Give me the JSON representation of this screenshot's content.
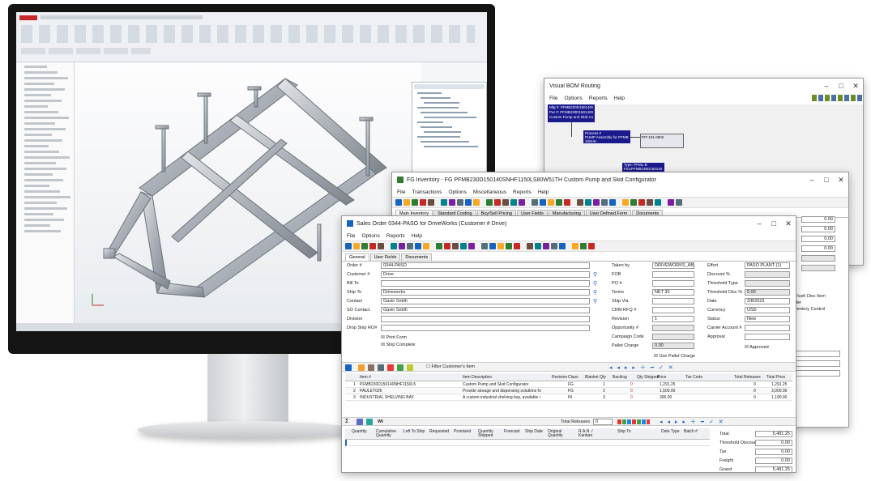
{
  "monitor": {
    "cad": {
      "tree_rows": 30
    }
  },
  "bom_window": {
    "title": "Visual BOM Routing",
    "menu": [
      "File",
      "Options",
      "Reports",
      "Help"
    ],
    "node1": [
      "Mfg #: PFMB230D150140SNH1150L5",
      "Pur #: PFMB230D150140SNH1150L5",
      "Custom Pump and Skid Configu"
    ],
    "node2": [
      "Process #",
      "PUMP Assembly for PFMB",
      "150HH"
    ],
    "node3": "PIT-101-0502",
    "node4": [
      "Type: PFML-B",
      "F01/PFMB230D150140",
      "Quan: 1"
    ]
  },
  "fg_window": {
    "title": "FG Inventory - FG PFMB230D150140SNHF1150LS80W51TH Custom Pump and Skid Configurator",
    "menu": [
      "File",
      "Transactions",
      "Options",
      "Miscellaneous",
      "Reports",
      "Help"
    ],
    "tabs": [
      "Main Inventory",
      "Standard Costing",
      "Buy/Sell Pricing",
      "User Fields",
      "Manufacturing",
      "User Defined Form",
      "Documents"
    ],
    "right_values": [
      "0.00",
      "0.00",
      "0.00",
      "0.00"
    ],
    "side_text": [
      "Flush Disc Item",
      "der",
      "ventory Control"
    ]
  },
  "so_window": {
    "title": "Sales Order 0344-PASO for DriveWorks (Customer # Drive)",
    "menu": [
      "File",
      "Options",
      "Reports",
      "Help"
    ],
    "tabs": [
      "General",
      "User Fields",
      "Documents"
    ],
    "left_fields": [
      {
        "label": "Order #",
        "value": "0344-PASO"
      },
      {
        "label": "Customer #",
        "value": "Drive"
      },
      {
        "label": "Bill To",
        "value": ""
      },
      {
        "label": "Ship To",
        "value": "Driveworks"
      },
      {
        "label": "Contact",
        "value": "Gavin Smith"
      },
      {
        "label": "SO Contact",
        "value": "Gavin Smith"
      },
      {
        "label": "Division",
        "value": ""
      },
      {
        "label": "Drop Ship RO#",
        "value": ""
      }
    ],
    "checks": [
      "Print Form",
      "Ship Complete"
    ],
    "mid_fields": [
      {
        "label": "Taken by",
        "value": "DRIVEWORKS_ABAM"
      },
      {
        "label": "FOB",
        "value": ""
      },
      {
        "label": "PO #",
        "value": ""
      },
      {
        "label": "Terms",
        "value": "NET 30"
      },
      {
        "label": "Ship Via",
        "value": ""
      },
      {
        "label": "CRM RFQ #",
        "value": ""
      },
      {
        "label": "Revision",
        "value": "1"
      },
      {
        "label": "Opportunity #",
        "value": ""
      },
      {
        "label": "Campaign Code",
        "value": ""
      },
      {
        "label": "Pallet Charge",
        "value": "0.00"
      }
    ],
    "use_pallet": "Use Pallet Charge",
    "right_fields": [
      {
        "label": "Effort",
        "value": "PASO PLANT (1)"
      },
      {
        "label": "Discount %",
        "value": ""
      },
      {
        "label": "Threshold Type",
        "value": ""
      },
      {
        "label": "Threshold Disc %",
        "value": "0.00"
      },
      {
        "label": "Date",
        "value": "2/8/2023"
      },
      {
        "label": "Currency",
        "value": "USD"
      },
      {
        "label": "Status",
        "value": "New"
      },
      {
        "label": "Carrier Account #",
        "value": ""
      },
      {
        "label": "Approval",
        "value": ""
      }
    ],
    "approval_checks": [
      "Required",
      "Approved"
    ],
    "filter_label": "Filter Customer's Item",
    "grid_headers": [
      "Item #",
      "Item Description",
      "Revision",
      "Class",
      "Blanket Qty",
      "Backlog",
      "Qty Shipped",
      "Price",
      "Tax Code",
      "Total Releases",
      "Total Price"
    ],
    "grid_rows": [
      {
        "n": "1",
        "item": "PFMB230D150140NHF1150L5",
        "desc": "Custom Pump and Skid Configurator",
        "cls": "FG",
        "blanket": "1",
        "backlog": "0",
        "price": "1,291.25",
        "rel": "0",
        "total": "1,291.25"
      },
      {
        "n": "2",
        "item": "PAULET026",
        "desc": "Provide storage and dispensing solutions fo",
        "cls": "FG",
        "blanket": "2",
        "backlog": "0",
        "price": "1,500.00",
        "rel": "0",
        "total": "3,000.00"
      },
      {
        "n": "3",
        "item": "INDUSTRIAL SHELVING BAY",
        "desc": "A custom industrial shelving bay, available i",
        "cls": "IN",
        "blanket": "3",
        "backlog": "0",
        "price": "395.00",
        "rel": "0",
        "total": "1,190.00"
      }
    ],
    "total_releases_label": "Total Releases",
    "total_releases_value": "0",
    "lower_headers": [
      "Quantity",
      "Cumulative Quantity",
      "Left To Ship",
      "Requested",
      "Promised",
      "Quantity Shipped",
      "Forecast",
      "Ship Date",
      "Original Quantity",
      "R.A.N. / Kanban",
      "Ship To",
      "Date Type",
      "Batch #"
    ],
    "totals": [
      {
        "label": "Total",
        "value": "5,481.25"
      },
      {
        "label": "Threshold Discour",
        "value": "0.00"
      },
      {
        "label": "Tax",
        "value": "0.00"
      },
      {
        "label": "Freight",
        "value": "0.00"
      },
      {
        "label": "Grand",
        "value": "5,481.25"
      }
    ],
    "lower_toolbar_label": "WI"
  },
  "colors": {
    "bom_blue": "#1a1a8c",
    "accent_red": "#c62828",
    "accent_green": "#2e7d32",
    "titlebar_bg": "#ffffff"
  }
}
